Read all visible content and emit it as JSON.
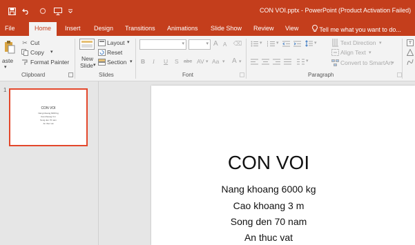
{
  "titlebar": {
    "doc_title": "CON VOI.pptx - PowerPoint (Product Activation Failed)",
    "qat": [
      {
        "icon": "save-icon"
      },
      {
        "icon": "undo-icon"
      },
      {
        "icon": "redo-icon"
      },
      {
        "icon": "start-slideshow-icon"
      },
      {
        "icon": "customize-qat-icon"
      }
    ]
  },
  "tabs": [
    "File",
    "Home",
    "Insert",
    "Design",
    "Transitions",
    "Animations",
    "Slide Show",
    "Review",
    "View"
  ],
  "active_tab": "Home",
  "tell_me": "Tell me what you want to do...",
  "ribbon": {
    "clipboard": {
      "paste_label": "aste",
      "cut": "Cut",
      "copy": "Copy",
      "format_painter": "Format Painter",
      "group": "Clipboard"
    },
    "slides": {
      "new_slide_1": "New",
      "new_slide_2": "Slide",
      "layout": "Layout",
      "reset": "Reset",
      "section": "Section",
      "group": "Slides"
    },
    "font": {
      "grow": "A",
      "shrink": "A",
      "bold": "B",
      "italic": "I",
      "underline": "U",
      "shadow": "S",
      "strike": "abc",
      "spacing": "AV",
      "case": "Aa",
      "color": "A",
      "group": "Font"
    },
    "paragraph": {
      "text_direction": "Text Direction",
      "align_text": "Align Text",
      "convert_smartart": "Convert to SmartArt",
      "group": "Paragraph"
    }
  },
  "slides_pane": {
    "slide_number": "1",
    "thumb_title": "CON VOI",
    "thumb_lines": [
      "Nang khoang 6000 kg",
      "Cao khoang 3 m",
      "Song den 70 nam",
      "An thuc vat"
    ]
  },
  "slide": {
    "title": "CON VOI",
    "lines": [
      "Nang khoang 6000 kg",
      "Cao khoang 3 m",
      "Song den 70 nam",
      "An thuc vat"
    ]
  },
  "colors": {
    "accent": "#c43e1c",
    "selection": "#e3462a"
  }
}
